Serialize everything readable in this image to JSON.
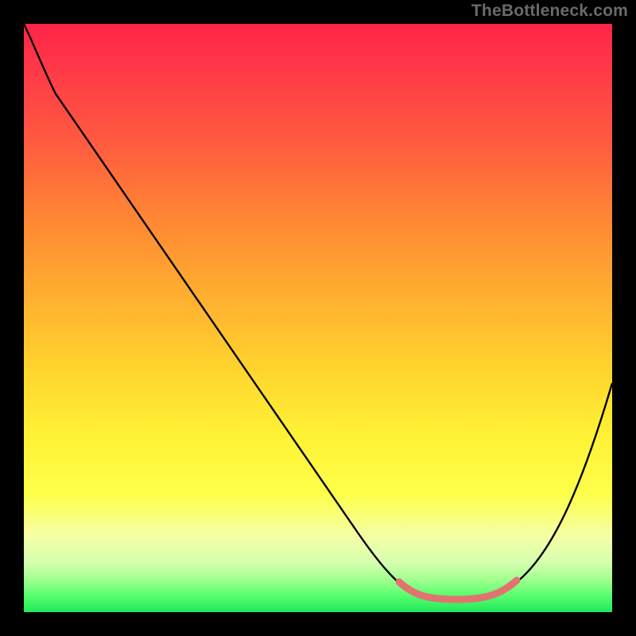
{
  "watermark": "TheBottleneck.com",
  "chart_data": {
    "type": "line",
    "title": "",
    "xlabel": "",
    "ylabel": "",
    "xlim": [
      0,
      100
    ],
    "ylim": [
      0,
      100
    ],
    "grid": false,
    "legend": false,
    "series": [
      {
        "name": "bottleneck-curve",
        "color": "#000000",
        "x": [
          0,
          4,
          10,
          20,
          30,
          40,
          50,
          56,
          60,
          64,
          68,
          72,
          76,
          80,
          84,
          88,
          92,
          96,
          100
        ],
        "y": [
          100,
          94,
          86,
          72,
          58,
          44,
          30,
          21,
          14,
          8,
          4,
          1,
          0,
          0,
          2,
          7,
          15,
          26,
          39
        ]
      },
      {
        "name": "optimal-range-highlight",
        "color": "#e2736f",
        "x": [
          64,
          68,
          72,
          76,
          80,
          84
        ],
        "y": [
          8,
          4,
          1,
          0,
          0,
          2
        ]
      }
    ],
    "optimal_range_x": [
      64,
      84
    ],
    "annotations": []
  },
  "colors": {
    "frame": "#000000",
    "gradient_top": "#ff2448",
    "gradient_mid": "#ffd22e",
    "gradient_bottom": "#1fe85a",
    "curve": "#000000",
    "highlight": "#e2736f",
    "watermark": "#6a6a6a"
  }
}
